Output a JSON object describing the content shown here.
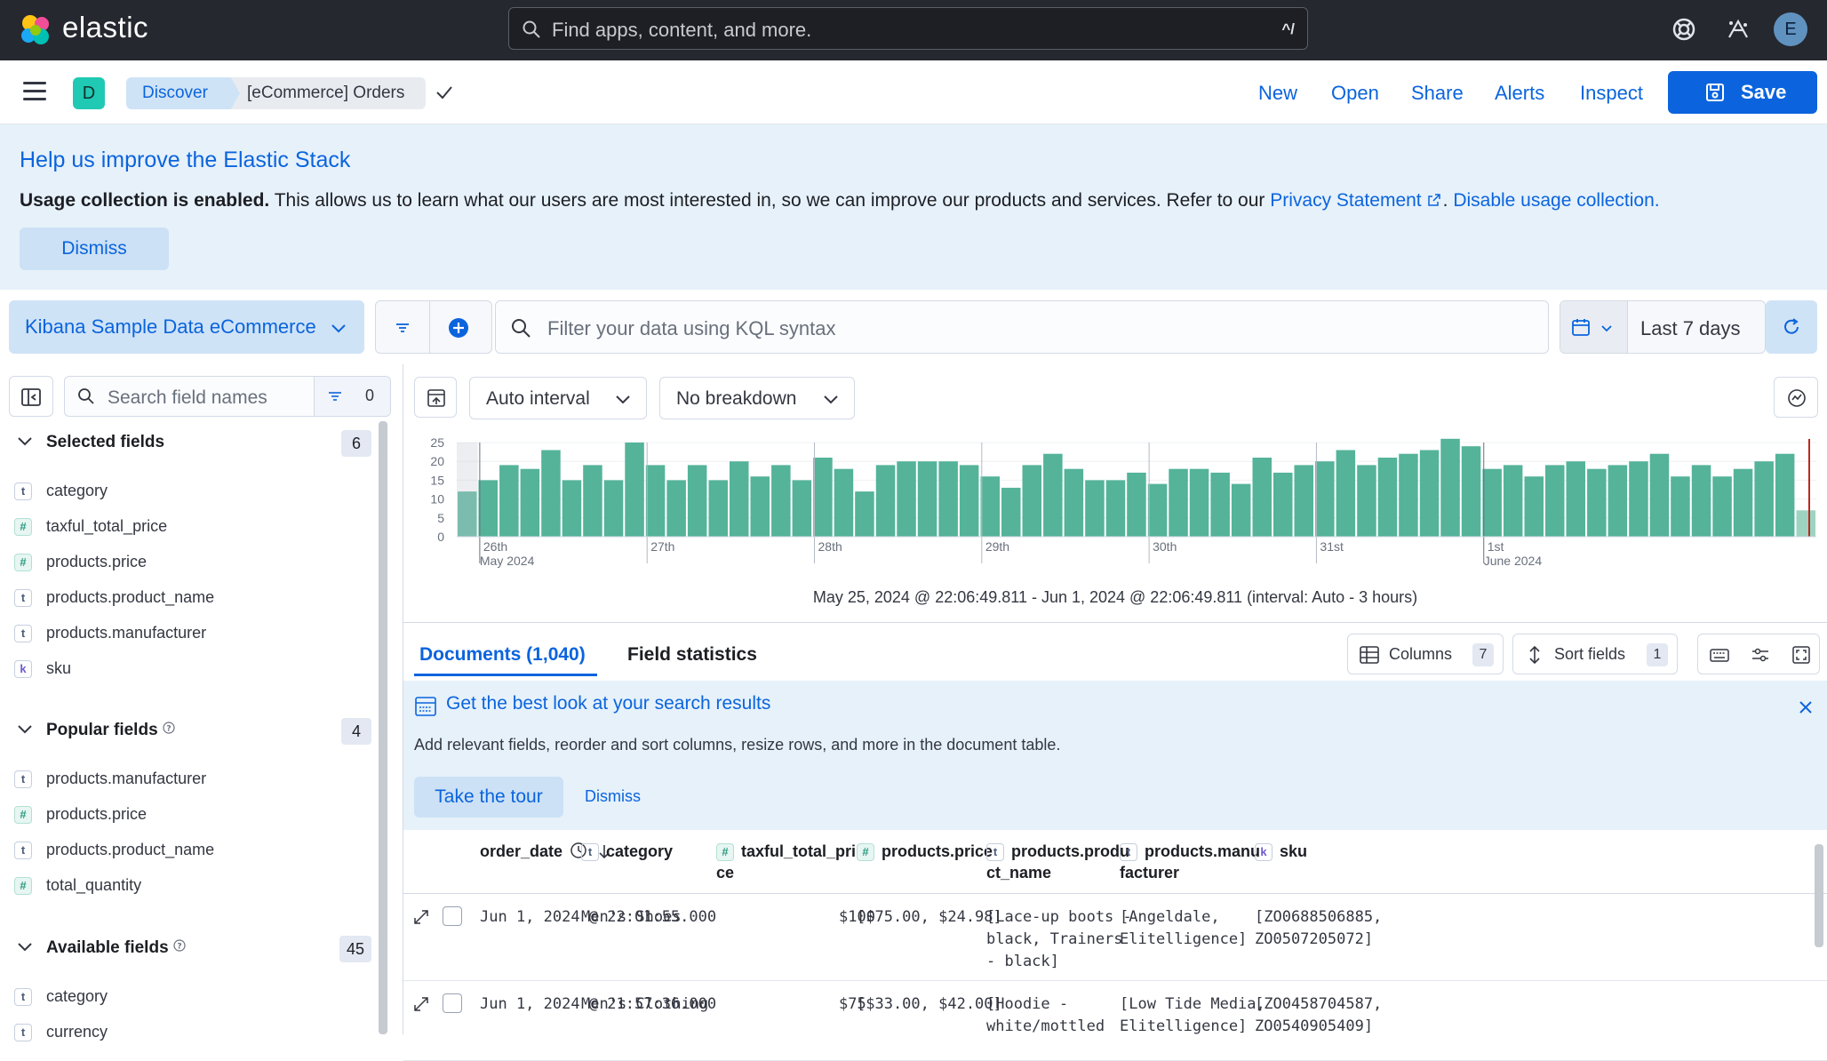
{
  "topbar": {
    "brand": "elastic",
    "search_placeholder": "Find apps, content, and more.",
    "search_shortcut": "^/",
    "avatar_initial": "E"
  },
  "navbar": {
    "space_initial": "D",
    "breadcrumbs": [
      "Discover",
      "[eCommerce] Orders"
    ],
    "links": [
      "New",
      "Open",
      "Share",
      "Alerts",
      "Inspect"
    ],
    "save_label": "Save"
  },
  "callout": {
    "title": "Help us improve the Elastic Stack",
    "bold": "Usage collection is enabled.",
    "text": " This allows us to learn what our users are most interested in, so we can improve our products and services. Refer to our ",
    "privacy_link": "Privacy Statement",
    "sep": ". ",
    "disable_link": "Disable usage collection.",
    "dismiss_label": "Dismiss"
  },
  "querybar": {
    "dataview": "Kibana Sample Data eCommerce",
    "kql_placeholder": "Filter your data using KQL syntax",
    "date_range": "Last 7 days"
  },
  "sidebar": {
    "search_placeholder": "Search field names",
    "filter_count": "0",
    "selected": {
      "label": "Selected fields",
      "count": "6",
      "items": [
        {
          "type": "t",
          "name": "category"
        },
        {
          "type": "#",
          "name": "taxful_total_price"
        },
        {
          "type": "#",
          "name": "products.price"
        },
        {
          "type": "t",
          "name": "products.product_name"
        },
        {
          "type": "t",
          "name": "products.manufacturer"
        },
        {
          "type": "k",
          "name": "sku"
        }
      ]
    },
    "popular": {
      "label": "Popular fields",
      "count": "4",
      "items": [
        {
          "type": "t",
          "name": "products.manufacturer"
        },
        {
          "type": "#",
          "name": "products.price"
        },
        {
          "type": "t",
          "name": "products.product_name"
        },
        {
          "type": "#",
          "name": "total_quantity"
        }
      ]
    },
    "available": {
      "label": "Available fields",
      "count": "45",
      "items": [
        {
          "type": "t",
          "name": "category"
        },
        {
          "type": "t",
          "name": "currency"
        }
      ]
    }
  },
  "chart_toolbar": {
    "interval": "Auto interval",
    "breakdown": "No breakdown"
  },
  "chart_data": {
    "type": "bar",
    "title": "",
    "xlabel": "",
    "ylabel": "",
    "ylim": [
      0,
      25
    ],
    "yticks": [
      "25",
      "20",
      "15",
      "10",
      "5",
      "0"
    ],
    "xticks": [
      {
        "label": "26th",
        "sub": "May 2024"
      },
      {
        "label": "27th",
        "sub": ""
      },
      {
        "label": "28th",
        "sub": ""
      },
      {
        "label": "29th",
        "sub": ""
      },
      {
        "label": "30th",
        "sub": ""
      },
      {
        "label": "31st",
        "sub": ""
      },
      {
        "label": "1st",
        "sub": "June 2024"
      }
    ],
    "values": [
      12,
      15,
      19,
      18,
      23,
      15,
      19,
      15,
      25,
      19,
      15,
      19,
      15,
      20,
      16,
      19,
      15,
      21,
      18,
      12,
      19,
      20,
      20,
      20,
      19,
      16,
      13,
      19,
      22,
      18,
      15,
      15,
      17,
      14,
      18,
      18,
      17,
      14,
      21,
      17,
      19,
      20,
      23,
      19,
      21,
      22,
      23,
      26,
      24,
      18,
      19,
      16,
      19,
      20,
      18,
      19,
      20,
      22,
      16,
      19,
      16,
      18,
      20,
      22,
      7
    ],
    "color": "#54b399",
    "partial_color": "#9ed3c2"
  },
  "timerange": "May 25, 2024 @ 22:06:49.811 - Jun 1, 2024 @ 22:06:49.811 (interval: Auto - 3 hours)",
  "tabs": {
    "documents": "Documents (1,040)",
    "field_stats": "Field statistics",
    "columns_label": "Columns",
    "columns_count": "7",
    "sort_label": "Sort fields",
    "sort_count": "1"
  },
  "tour": {
    "title": "Get the best look at your search results",
    "text": "Add relevant fields, reorder and sort columns, resize rows, and more in the document table.",
    "button": "Take the tour",
    "dismiss": "Dismiss"
  },
  "table": {
    "headers": [
      {
        "tok": "",
        "label": "order_date"
      },
      {
        "tok": "t",
        "label": "category"
      },
      {
        "tok": "#",
        "label": "taxful_total_pri\nce"
      },
      {
        "tok": "#",
        "label": "products.price"
      },
      {
        "tok": "t",
        "label": "products.produ\nct_name"
      },
      {
        "tok": "t",
        "label": "products.manu\nfacturer"
      },
      {
        "tok": "k",
        "label": "sku"
      }
    ],
    "rows": [
      {
        "order_date": "Jun 1, 2024 @ 22:01:55.000",
        "category": "Men's Shoes",
        "taxful_total_price": "$100",
        "products_price": "[$75.00, $24.98]",
        "product_name": "[Lace-up boots -\nblack, Trainers\n- black]",
        "manufacturer": "[Angeldale,\nElitelligence]",
        "sku": "[ZO0688506885,\nZO0507205072]"
      },
      {
        "order_date": "Jun 1, 2024 @ 21:57:36.000",
        "category": "Men's Clothing",
        "taxful_total_price": "$75",
        "products_price": "[$33.00, $42.00]",
        "product_name": "[Hoodie -\nwhite/mottled",
        "manufacturer": "[Low Tide Media,\nElitelligence]",
        "sku": "[ZO0458704587,\nZO0540905409]"
      }
    ]
  }
}
